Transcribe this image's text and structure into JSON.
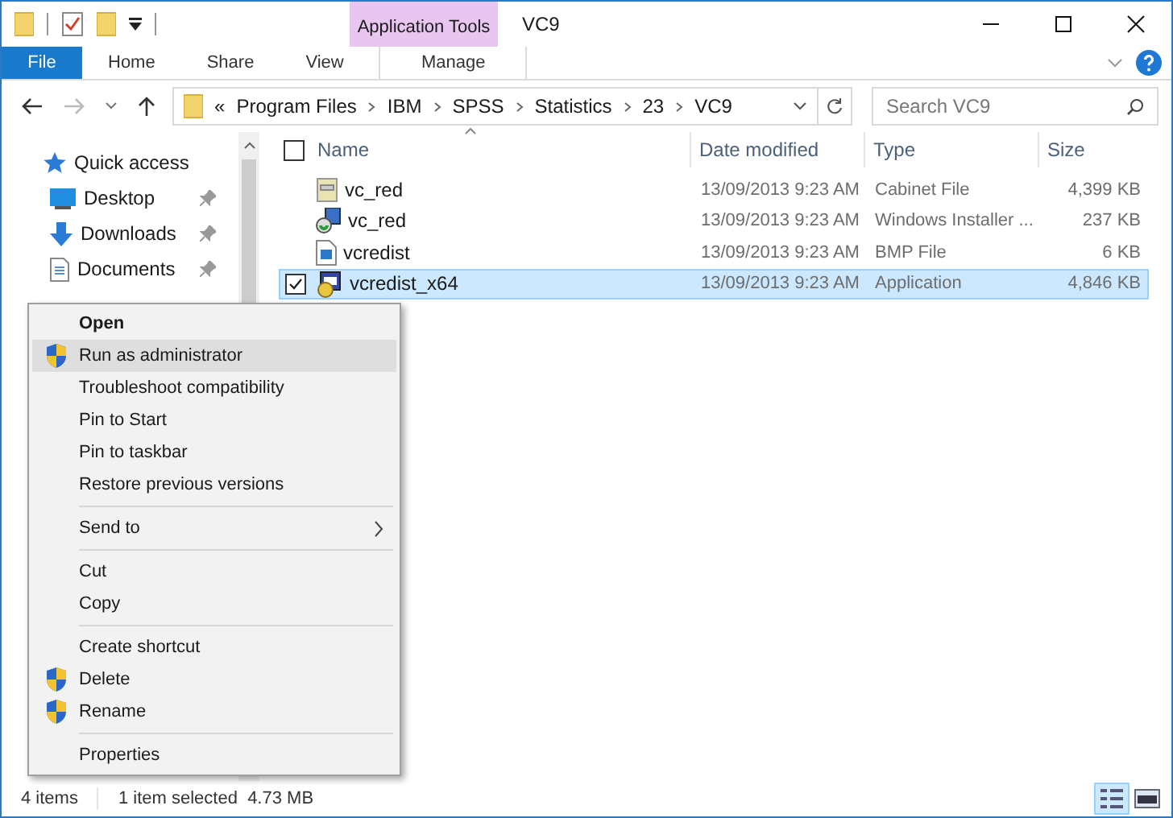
{
  "window": {
    "title": "VC9",
    "context_tab_group": "Application Tools"
  },
  "ribbon_tabs": [
    {
      "label": "File",
      "kind": "file",
      "selected": false
    },
    {
      "label": "Home",
      "kind": "tab",
      "selected": false
    },
    {
      "label": "Share",
      "kind": "tab",
      "selected": false
    },
    {
      "label": "View",
      "kind": "tab",
      "selected": false
    },
    {
      "label": "Manage",
      "kind": "context",
      "selected": false
    }
  ],
  "breadcrumb": {
    "overflow": "«",
    "segments": [
      "Program Files",
      "IBM",
      "SPSS",
      "Statistics",
      "23",
      "VC9"
    ]
  },
  "search": {
    "placeholder": "Search VC9"
  },
  "sidebar": {
    "items": [
      {
        "label": "Quick access",
        "kind": "star",
        "pinned": false
      },
      {
        "label": "Desktop",
        "kind": "desktop",
        "pinned": true
      },
      {
        "label": "Downloads",
        "kind": "download",
        "pinned": true
      },
      {
        "label": "Documents",
        "kind": "document",
        "pinned": true
      }
    ]
  },
  "table": {
    "select_all_checked": false,
    "columns": [
      "Name",
      "Date modified",
      "Type",
      "Size"
    ],
    "rows": [
      {
        "name": "vc_red",
        "date": "13/09/2013 9:23 AM",
        "type": "Cabinet File",
        "size": "4,399 KB",
        "kind": "cabinet",
        "selected": false
      },
      {
        "name": "vc_red",
        "date": "13/09/2013 9:23 AM",
        "type": "Windows Installer ...",
        "size": "237 KB",
        "kind": "installer",
        "selected": false
      },
      {
        "name": "vcredist",
        "date": "13/09/2013 9:23 AM",
        "type": "BMP File",
        "size": "6 KB",
        "kind": "image",
        "selected": false
      },
      {
        "name": "vcredist_x64",
        "date": "13/09/2013 9:23 AM",
        "type": "Application",
        "size": "4,846 KB",
        "kind": "app",
        "selected": true
      }
    ]
  },
  "context_menu": {
    "groups": [
      [
        {
          "label": "Open",
          "kind": "default",
          "selected": false
        },
        {
          "label": "Run as administrator",
          "kind": "shield",
          "selected": true
        },
        {
          "label": "Troubleshoot compatibility",
          "kind": "plain",
          "selected": false
        },
        {
          "label": "Pin to Start",
          "kind": "plain",
          "selected": false
        },
        {
          "label": "Pin to taskbar",
          "kind": "plain",
          "selected": false
        },
        {
          "label": "Restore previous versions",
          "kind": "plain",
          "selected": false
        }
      ],
      [
        {
          "label": "Send to",
          "kind": "submenu",
          "selected": false
        }
      ],
      [
        {
          "label": "Cut",
          "kind": "plain",
          "selected": false
        },
        {
          "label": "Copy",
          "kind": "plain",
          "selected": false
        }
      ],
      [
        {
          "label": "Create shortcut",
          "kind": "plain",
          "selected": false
        },
        {
          "label": "Delete",
          "kind": "shield",
          "selected": false
        },
        {
          "label": "Rename",
          "kind": "shield",
          "selected": false
        }
      ],
      [
        {
          "label": "Properties",
          "kind": "plain",
          "selected": false
        }
      ]
    ]
  },
  "status_bar": {
    "count": "4 items",
    "selection": "1 item selected  4.73 MB"
  }
}
